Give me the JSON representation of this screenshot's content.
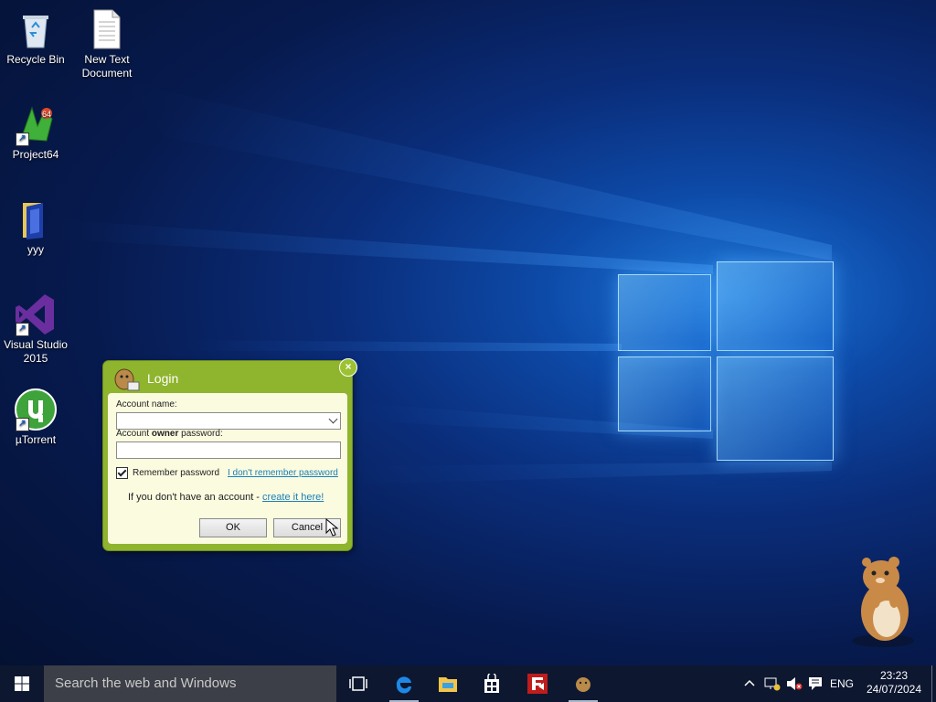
{
  "desktop": {
    "icons": [
      {
        "label": "Recycle Bin"
      },
      {
        "label": "New Text Document"
      },
      {
        "label": "Project64"
      },
      {
        "label": "yyy"
      },
      {
        "label": "Visual Studio 2015"
      },
      {
        "label": "µTorrent"
      }
    ]
  },
  "login_dialog": {
    "title": "Login",
    "close_glyph": "×",
    "account_name_label": "Account name:",
    "account_name_value": "",
    "password_label_prefix": "Account ",
    "password_label_bold": "owner",
    "password_label_suffix": " password:",
    "password_value": "",
    "remember_label": "Remember password",
    "remember_checked": true,
    "forgot_link": "I don't remember password",
    "no_account_text": "If you don't have an account - ",
    "create_link": "create it here!",
    "ok_label": "OK",
    "cancel_label": "Cancel"
  },
  "taskbar": {
    "search_placeholder": "Search the web and Windows",
    "language": "ENG",
    "time": "23:23",
    "date": "24/07/2024"
  },
  "colors": {
    "dialog_green": "#8fb42e",
    "dialog_body": "#fbfbe0",
    "link": "#1a7fb8",
    "taskbar": "#0d1730"
  }
}
